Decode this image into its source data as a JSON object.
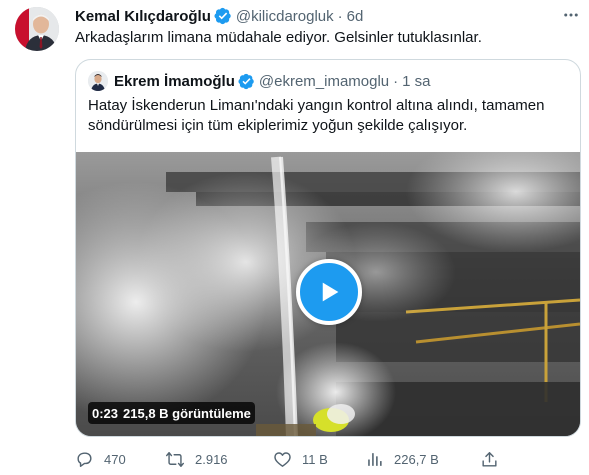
{
  "tweet": {
    "author_name": "Kemal Kılıçdaroğlu",
    "author_handle": "@kilicdarogluk",
    "separator": "·",
    "time": "6d",
    "text": "Arkadaşlarım limana müdahale ediyor. Gelsinler tutuklasınlar.",
    "more_icon": "more-dots-icon"
  },
  "quote": {
    "author_name": "Ekrem İmamoğlu",
    "author_handle": "@ekrem_imamoglu",
    "separator": "·",
    "time": "1 sa",
    "text": "Hatay İskenderun Limanı'ndaki yangın kontrol altına alındı, tamamen söndürülmesi için tüm ekiplerimiz yoğun şekilde çalışıyor.",
    "video": {
      "duration": "0:23",
      "views": "215,8 B görüntüleme"
    }
  },
  "actions": {
    "reply_count": "470",
    "retweet_count": "2.916",
    "like_count": "11 B",
    "view_count": "226,7 B"
  },
  "colors": {
    "accent": "#1d9bf0",
    "text": "#0f1419",
    "muted": "#536471",
    "border": "#cfd9de"
  }
}
